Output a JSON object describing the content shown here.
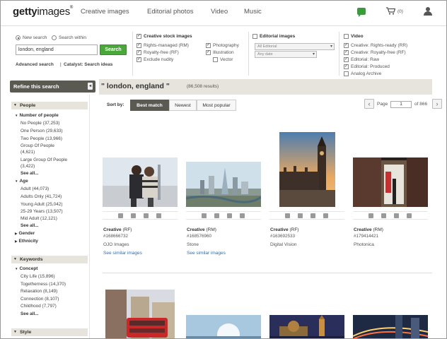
{
  "header": {
    "logo_bold": "getty",
    "logo_light": "images",
    "logo_mark": "®",
    "nav": [
      "Creative images",
      "Editorial photos",
      "Video",
      "Music"
    ],
    "cart_count": "(0)",
    "icons": [
      "chat-icon",
      "cart-icon",
      "user-icon"
    ]
  },
  "search": {
    "mode_new": "New search",
    "mode_within": "Search within",
    "query_value": "london, england",
    "button": "Search",
    "advanced": "Advanced search",
    "separator": "|",
    "catalyst": "Catalyst: Search ideas"
  },
  "filters": {
    "creative_head": "Creative stock images",
    "rights_managed": "Rights-managed (RM)",
    "royalty_free": "Royalty-free (RF)",
    "exclude_nudity": "Exclude nudity",
    "photography": "Photography",
    "illustration": "Illustration",
    "vector": "Vector",
    "editorial_head": "Editorial images",
    "editorial_select": "All Editorial",
    "date_select": "Any date",
    "video_head": "Video",
    "video_items": [
      "Creative: Rights-ready (RR)",
      "Creative: Royalty-free (RF)",
      "Editorial: Raw",
      "Editorial: Produced",
      "Analog Archive"
    ]
  },
  "refine": {
    "title": "Refine this search",
    "collapse_arrow": "◂"
  },
  "facets": {
    "people_head": "People",
    "number_head": "Number of people",
    "number_items": [
      "No People (37,253)",
      "One Person (29,633)",
      "Two People (13,966)",
      "Group Of People",
      "(4,621)",
      "Large Group Of People",
      "(3,422)"
    ],
    "age_head": "Age",
    "age_items": [
      "Adult (44,073)",
      "Adults Only (41,724)",
      "Young Adult (25,042)",
      "25-29 Years (13,507)",
      "Mid Adult (12,121)"
    ],
    "gender_head": "Gender",
    "ethnicity_head": "Ethnicity",
    "keywords_head": "Keywords",
    "concept_head": "Concept",
    "concept_items": [
      "City Life (15,896)",
      "Togetherness (14,370)",
      "Relaxation (8,149)",
      "Connection (8,107)",
      "Childhood (7,797)"
    ],
    "see_all": "See all...",
    "style_head": "Style"
  },
  "results": {
    "query_display": "\" london, england \"",
    "count": "(86,508 results)",
    "sort_label": "Sort by:",
    "sort_options": [
      "Best match",
      "Newest",
      "Most popular"
    ],
    "page_label": "Page",
    "page_value": "1",
    "page_of": "of 866",
    "items": [
      {
        "license": "Creative",
        "type": "(RF)",
        "id": "#168666732",
        "source": "OJO Images",
        "similar": "See similar images"
      },
      {
        "license": "Creative",
        "type": "(RM)",
        "id": "#168576960",
        "source": "Stone",
        "similar": "See similar images"
      },
      {
        "license": "Creative",
        "type": "(RF)",
        "id": "#163692533",
        "source": "Digital Vision",
        "similar": ""
      },
      {
        "license": "Creative",
        "type": "(RM)",
        "id": "#179414421",
        "source": "Photonica",
        "similar": ""
      }
    ]
  },
  "colors": {
    "search_green": "#4aa83a",
    "refine_bg": "#5a5a52",
    "facet_bg": "#e6e4dc",
    "link_blue": "#2a6fb5"
  }
}
